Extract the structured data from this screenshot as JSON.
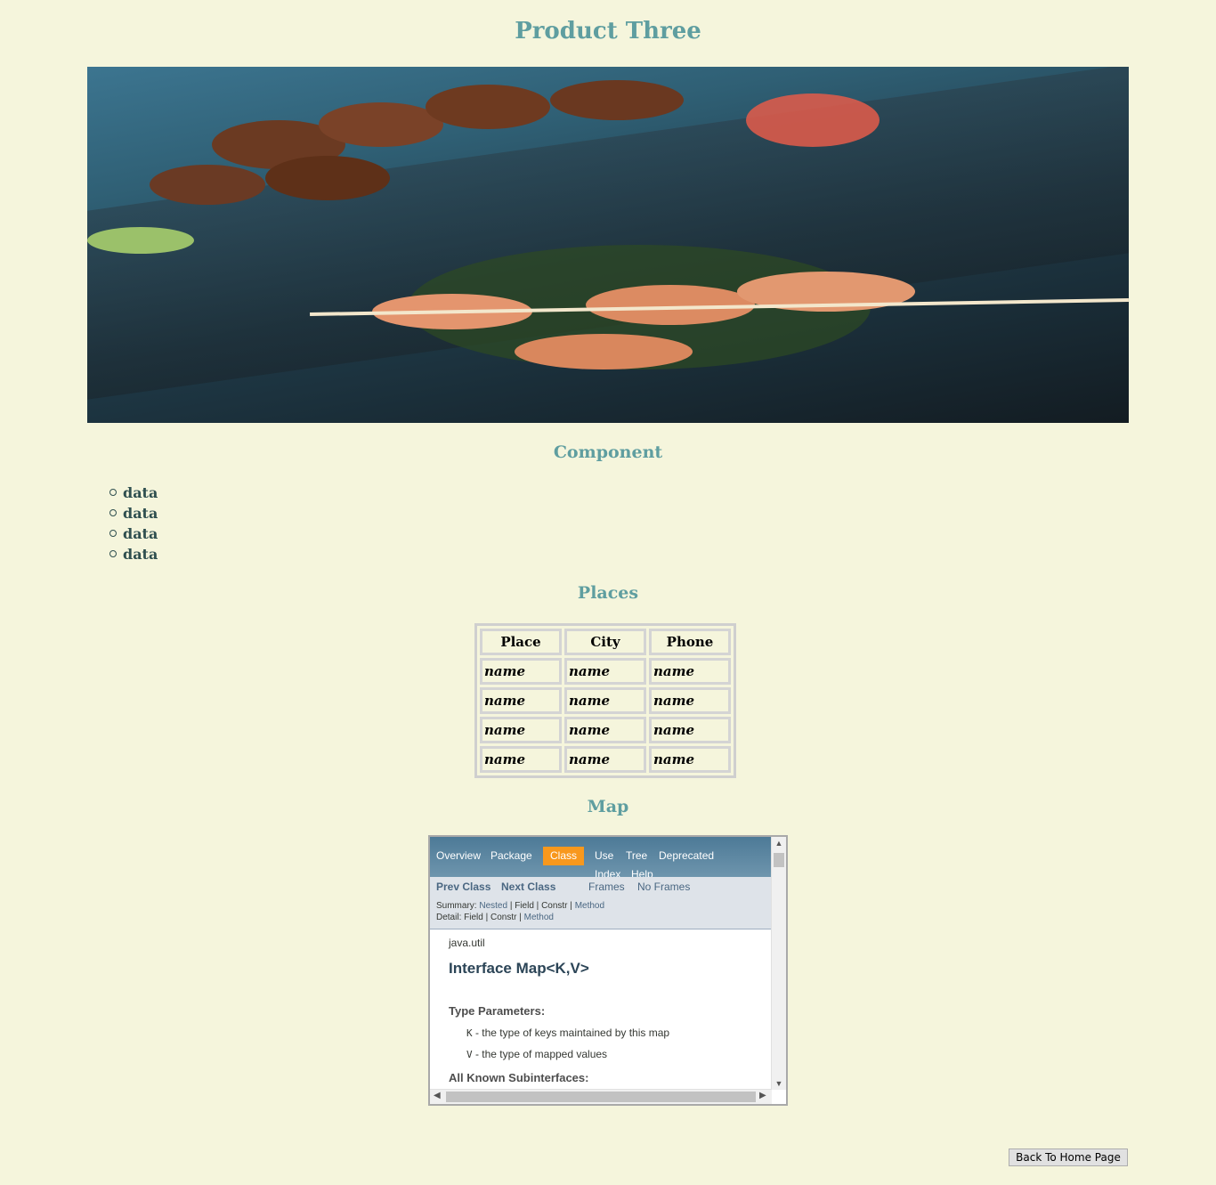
{
  "page": {
    "title": "Product Three",
    "hero_image_description": ""
  },
  "component": {
    "heading": "Component",
    "items": [
      "data",
      "data",
      "data",
      "data"
    ]
  },
  "places": {
    "heading": "Places",
    "columns": [
      "Place",
      "City",
      "Phone"
    ],
    "rows": [
      [
        "name",
        "name",
        "name"
      ],
      [
        "name",
        "name",
        "name"
      ],
      [
        "name",
        "name",
        "name"
      ],
      [
        "name",
        "name",
        "name"
      ]
    ]
  },
  "map": {
    "heading": "Map",
    "nav": {
      "items": [
        "Overview",
        "Package",
        "Class",
        "Use",
        "Tree",
        "Deprecated",
        "Index",
        "Help"
      ],
      "active": "Class"
    },
    "subnav": {
      "prev": "Prev Class",
      "next": "Next Class",
      "frames": "Frames",
      "no_frames": "No Frames",
      "summary_label": "Summary:",
      "summary_nested": "Nested",
      "summary_field": "Field",
      "summary_constr": "Constr",
      "summary_method": "Method",
      "detail_label": "Detail:",
      "detail_field": "Field",
      "detail_constr": "Constr",
      "detail_method": "Method",
      "sep": "|"
    },
    "doc": {
      "package": "java.util",
      "title": "Interface Map<K,V>",
      "type_params_heading": "Type Parameters:",
      "param_k_name": "K",
      "param_k_desc": " - the type of keys maintained by this map",
      "param_v_name": "V",
      "param_v_desc": " - the type of mapped values",
      "subinterfaces_heading": "All Known Subinterfaces:"
    }
  },
  "footer": {
    "back_label": "Back To Home Page"
  },
  "colors": {
    "background": "#f5f5dc",
    "heading": "#5f9ea0",
    "nav_active": "#f8981d"
  }
}
